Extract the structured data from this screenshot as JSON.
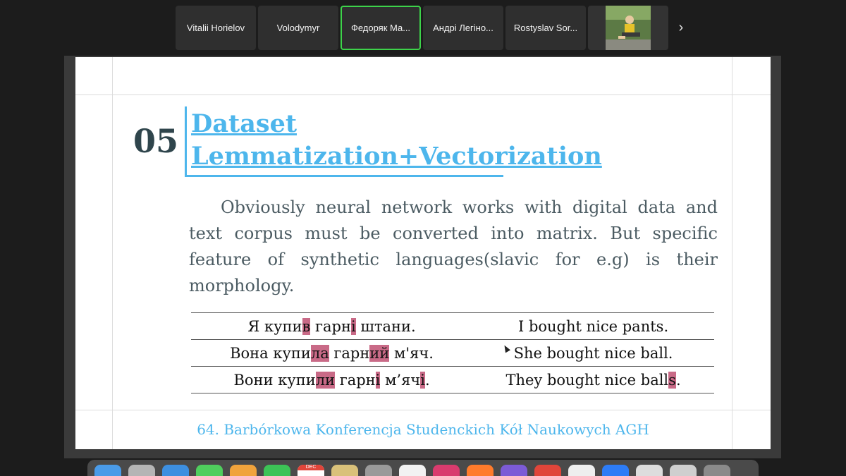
{
  "participants": [
    {
      "name": "Vitalii Horielov",
      "active": false
    },
    {
      "name": "Volodymyr",
      "active": false
    },
    {
      "name": "Федоряк Ма...",
      "active": true
    },
    {
      "name": "Андрі Легіно...",
      "active": false
    },
    {
      "name": "Rostyslav Sor...",
      "active": false
    }
  ],
  "video_tile": {
    "icon": "participant-video-thumbnail"
  },
  "next_icon": "›",
  "slide": {
    "number": "05",
    "title_line1": "Dataset",
    "title_line2": "Lemmatization+Vectorization",
    "paragraph": "Obviously neural network works with digital data and text corpus must be converted into matrix. But specific feature of synthetic languages(slavic for e.g) is their morphology.",
    "rows": [
      {
        "uk": [
          {
            "t": "Я купи",
            "h": false
          },
          {
            "t": "в",
            "h": true
          },
          {
            "t": " гарн",
            "h": false
          },
          {
            "t": "і",
            "h": true
          },
          {
            "t": " штани.",
            "h": false
          }
        ],
        "en": [
          {
            "t": "I bought nice pants.",
            "h": false
          }
        ]
      },
      {
        "uk": [
          {
            "t": "Вона купи",
            "h": false
          },
          {
            "t": "ла",
            "h": true
          },
          {
            "t": " гарн",
            "h": false
          },
          {
            "t": "ий",
            "h": true
          },
          {
            "t": " м'яч.",
            "h": false
          }
        ],
        "en": [
          {
            "t": "She bought nice ball.",
            "h": false
          }
        ]
      },
      {
        "uk": [
          {
            "t": "Вони купи",
            "h": false
          },
          {
            "t": "ли",
            "h": true
          },
          {
            "t": " гарн",
            "h": false
          },
          {
            "t": "і",
            "h": true
          },
          {
            "t": " м’яч",
            "h": false
          },
          {
            "t": "і",
            "h": true
          },
          {
            "t": ".",
            "h": false
          }
        ],
        "en": [
          {
            "t": "They bought nice ball",
            "h": false
          },
          {
            "t": "s",
            "h": true
          },
          {
            "t": ".",
            "h": false
          }
        ]
      }
    ],
    "footer": "64. Barbórkowa Konferencja Studenckich Kół Naukowych AGH"
  },
  "colors": {
    "accent": "#4db6ec",
    "highlight": "#c96a87",
    "number": "#2f454c",
    "body_text": "#4b5b62",
    "active_border": "#3dd34a"
  },
  "dock": {
    "apps": [
      "finder-icon",
      "launchpad-icon",
      "safari-icon",
      "messages-icon",
      "photos-icon",
      "facetime-icon",
      "calendar-icon",
      "notes-icon",
      "system-preferences-icon",
      "app-icon",
      "jetbrains-icon",
      "firefox-icon",
      "viber-icon",
      "chrome-icon",
      "document-icon",
      "zoom-icon",
      "pen-icon",
      "preview-icon",
      "trash-icon"
    ],
    "calendar_month": "DEC"
  }
}
